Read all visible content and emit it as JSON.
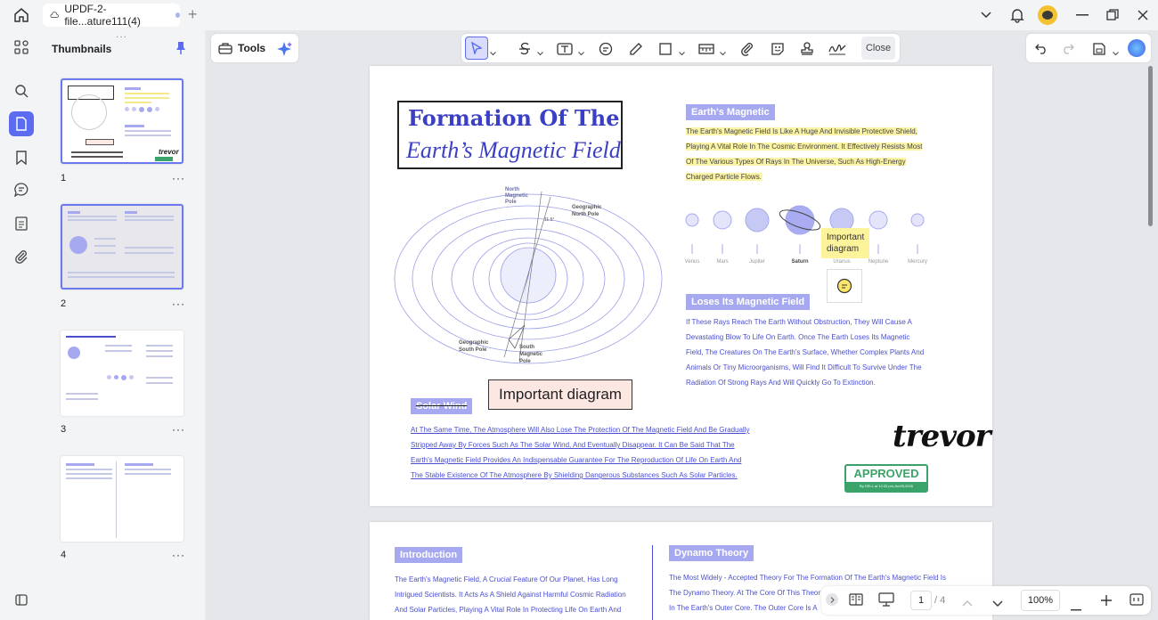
{
  "window": {
    "tab_title": "UPDF-2-file...ature111(4)",
    "new_tab": "+"
  },
  "left_panel": {
    "title": "Thumbnails",
    "pages": [
      "1",
      "2",
      "3",
      "4"
    ],
    "more": "···"
  },
  "toolbar": {
    "tools_label": "Tools",
    "close_label": "Close"
  },
  "page1": {
    "title_line1": "Formation Of The",
    "title_line2": "Earth’s Magnetic Field",
    "earth_magnetic_label": "Earth's Magnetic",
    "earth_magnetic_lines": [
      "The Earth's Magnetic Field Is Like A Huge And Invisible Protective Shield,",
      "Playing A Vital Role In The Cosmic Environment. It Effectively Resists Most",
      "Of The Various Types Of Rays In The Universe, Such As High-Energy",
      "Charged Particle Flows."
    ],
    "planets": [
      "Venus",
      "Mars",
      "Jupiter",
      "Saturn",
      "Uranus",
      "Neptune",
      "Mercury"
    ],
    "sticky_note": "Important diagram",
    "diagram_labels": {
      "north_magnetic": "North Magnetic Pole",
      "geo_north": "Geographic North Pole",
      "geo_south": "Geographic South Pole",
      "south_magnetic": "South Magnetic Pole",
      "angle": "11.5°"
    },
    "callout": "Important diagram",
    "loses_label": "Loses Its Magnetic Field",
    "loses_lines": [
      "If These Rays Reach The Earth Without Obstruction, They Will Cause A",
      "Devastating Blow To Life On Earth. Once The Earth Loses Its Magnetic",
      "Field, The Creatures On The Earth's Surface, Whether Complex Plants And",
      "Animals Or Tiny Microorganisms, Will Find It Difficult To Survive Under The",
      "Radiation Of Strong Rays And Will Quickly Go To Extinction."
    ],
    "solar_label": "Solar Wind",
    "solar_lines": [
      "At The Same Time, The Atmosphere Will Also Lose The Protection Of The Magnetic Field And Be Gradually",
      "Stripped Away By Forces Such As The Solar Wind, And Eventually Disappear. It Can Be Said That The",
      "Earth's Magnetic Field Provides An Indispensable Guarantee For The Reproduction Of Life On Earth And",
      "The Stable Existence Of The Atmosphere By Shielding Dangerous Substances Such As Solar Particles."
    ],
    "signature": "trevor",
    "stamp_main": "APPROVED",
    "stamp_sub": "By DELL at 12:33 pm,Jun05,2026"
  },
  "page2": {
    "intro_label": "Introduction",
    "intro_lines": [
      "The Earth's Magnetic Field, A Crucial Feature Of Our Planet, Has Long",
      "Intrigued Scientists. It Acts As A Shield Against Harmful Cosmic Radiation",
      "And Solar Particles, Playing A Vital Role In Protecting Life On Earth And"
    ],
    "dynamo_label": "Dynamo Theory",
    "dynamo_lines": [
      "The Most Widely - Accepted Theory For The Formation Of The Earth's Magnetic Field Is",
      "The Dynamo Theory. At The Core Of This Theor",
      "In The Earth's Outer Core. The Outer Core Is A"
    ]
  },
  "bottom_bar": {
    "page_current": "1",
    "page_total": "/ 4",
    "zoom": "100%"
  },
  "colors": {
    "accent": "#5b6cf0",
    "label_bg": "#a6a9ef",
    "body_text": "#4a4fd1",
    "highlight": "#fbf3a6",
    "title": "#3a3fc4"
  }
}
